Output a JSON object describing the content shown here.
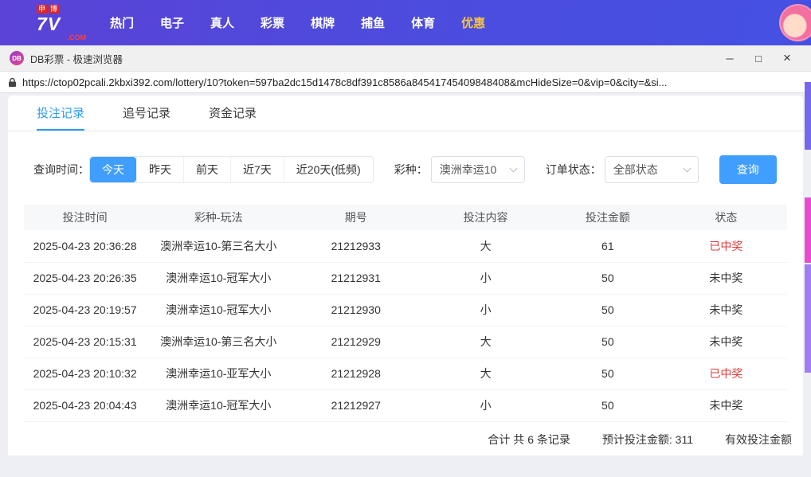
{
  "top_nav": {
    "logo": {
      "tag1": "申",
      "tag2": "博",
      "main": "7V",
      "sub": ".COM"
    },
    "items": [
      {
        "label": "热门"
      },
      {
        "label": "电子"
      },
      {
        "label": "真人"
      },
      {
        "label": "彩票"
      },
      {
        "label": "棋牌"
      },
      {
        "label": "捕鱼"
      },
      {
        "label": "体育"
      },
      {
        "label": "优惠"
      }
    ]
  },
  "browser": {
    "title": "DB彩票 - 极速浏览器",
    "app_icon": "DB",
    "url": "https://ctop02pcali.2kbxi392.com/lottery/10?token=597ba2dc15d1478c8df391c8586a84541745409848408&mcHideSize=0&vip=0&city=&si...",
    "controls": {
      "minimize_icon": "─",
      "maximize_icon": "□",
      "close_icon": "×"
    }
  },
  "tabs": [
    {
      "label": "投注记录",
      "active": true
    },
    {
      "label": "追号记录",
      "active": false
    },
    {
      "label": "资金记录",
      "active": false
    }
  ],
  "filters": {
    "time_label": "查询时间：",
    "time_options": [
      "今天",
      "昨天",
      "前天",
      "近7天",
      "近20天(低频)"
    ],
    "time_active": "今天",
    "lottery_label": "彩种：",
    "lottery_value": "澳洲幸运10",
    "status_label": "订单状态：",
    "status_value": "全部状态",
    "query_label": "查询"
  },
  "table": {
    "headers": [
      "投注时间",
      "彩种-玩法",
      "期号",
      "投注内容",
      "投注金额",
      "状态"
    ],
    "rows": [
      {
        "time": "2025-04-23 20:36:28",
        "game": "澳洲幸运10-第三名大小",
        "issue": "21212933",
        "content": "大",
        "amount": "61",
        "status": "已中奖"
      },
      {
        "time": "2025-04-23 20:26:35",
        "game": "澳洲幸运10-冠军大小",
        "issue": "21212931",
        "content": "小",
        "amount": "50",
        "status": "未中奖"
      },
      {
        "time": "2025-04-23 20:19:57",
        "game": "澳洲幸运10-冠军大小",
        "issue": "21212930",
        "content": "小",
        "amount": "50",
        "status": "未中奖"
      },
      {
        "time": "2025-04-23 20:15:31",
        "game": "澳洲幸运10-第三名大小",
        "issue": "21212929",
        "content": "大",
        "amount": "50",
        "status": "未中奖"
      },
      {
        "time": "2025-04-23 20:10:32",
        "game": "澳洲幸运10-亚军大小",
        "issue": "21212928",
        "content": "大",
        "amount": "50",
        "status": "已中奖"
      },
      {
        "time": "2025-04-23 20:04:43",
        "game": "澳洲幸运10-冠军大小",
        "issue": "21212927",
        "content": "小",
        "amount": "50",
        "status": "未中奖"
      }
    ]
  },
  "summary": {
    "total": "合计 共 6 条记录",
    "estimated": "预计投注金额: 311",
    "valid": "有效投注金额"
  },
  "colors": {
    "accent_blue": "#409eff",
    "tab_active_blue": "#2b9bf4",
    "win_red": "#e23b3b",
    "promo_gold": "#f6c343"
  }
}
